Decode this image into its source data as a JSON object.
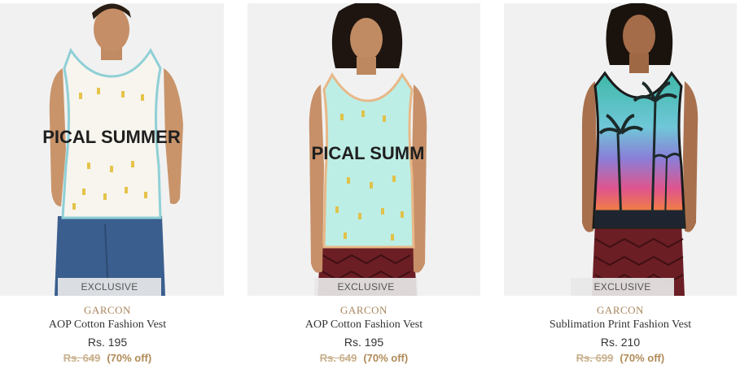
{
  "products": [
    {
      "badge": "EXCLUSIVE",
      "brand": "GARCON",
      "name": "AOP Cotton Fashion Vest",
      "price": "Rs. 195",
      "original_price": "Rs. 649",
      "discount": "(70% off)",
      "print_text": "PICAL SUMMER"
    },
    {
      "badge": "EXCLUSIVE",
      "brand": "GARCON",
      "name": "AOP Cotton Fashion Vest",
      "price": "Rs. 195",
      "original_price": "Rs. 649",
      "discount": "(70% off)",
      "print_text": "PICAL SUMM"
    },
    {
      "badge": "EXCLUSIVE",
      "brand": "GARCON",
      "name": "Sublimation Print Fashion Vest",
      "price": "Rs. 210",
      "original_price": "Rs. 699",
      "discount": "(70% off)"
    }
  ],
  "colors": {
    "brand": "#a8875d",
    "strike_price": "#c9b08c",
    "discount": "#b08a57",
    "image_bg": "#f1f1f1"
  }
}
